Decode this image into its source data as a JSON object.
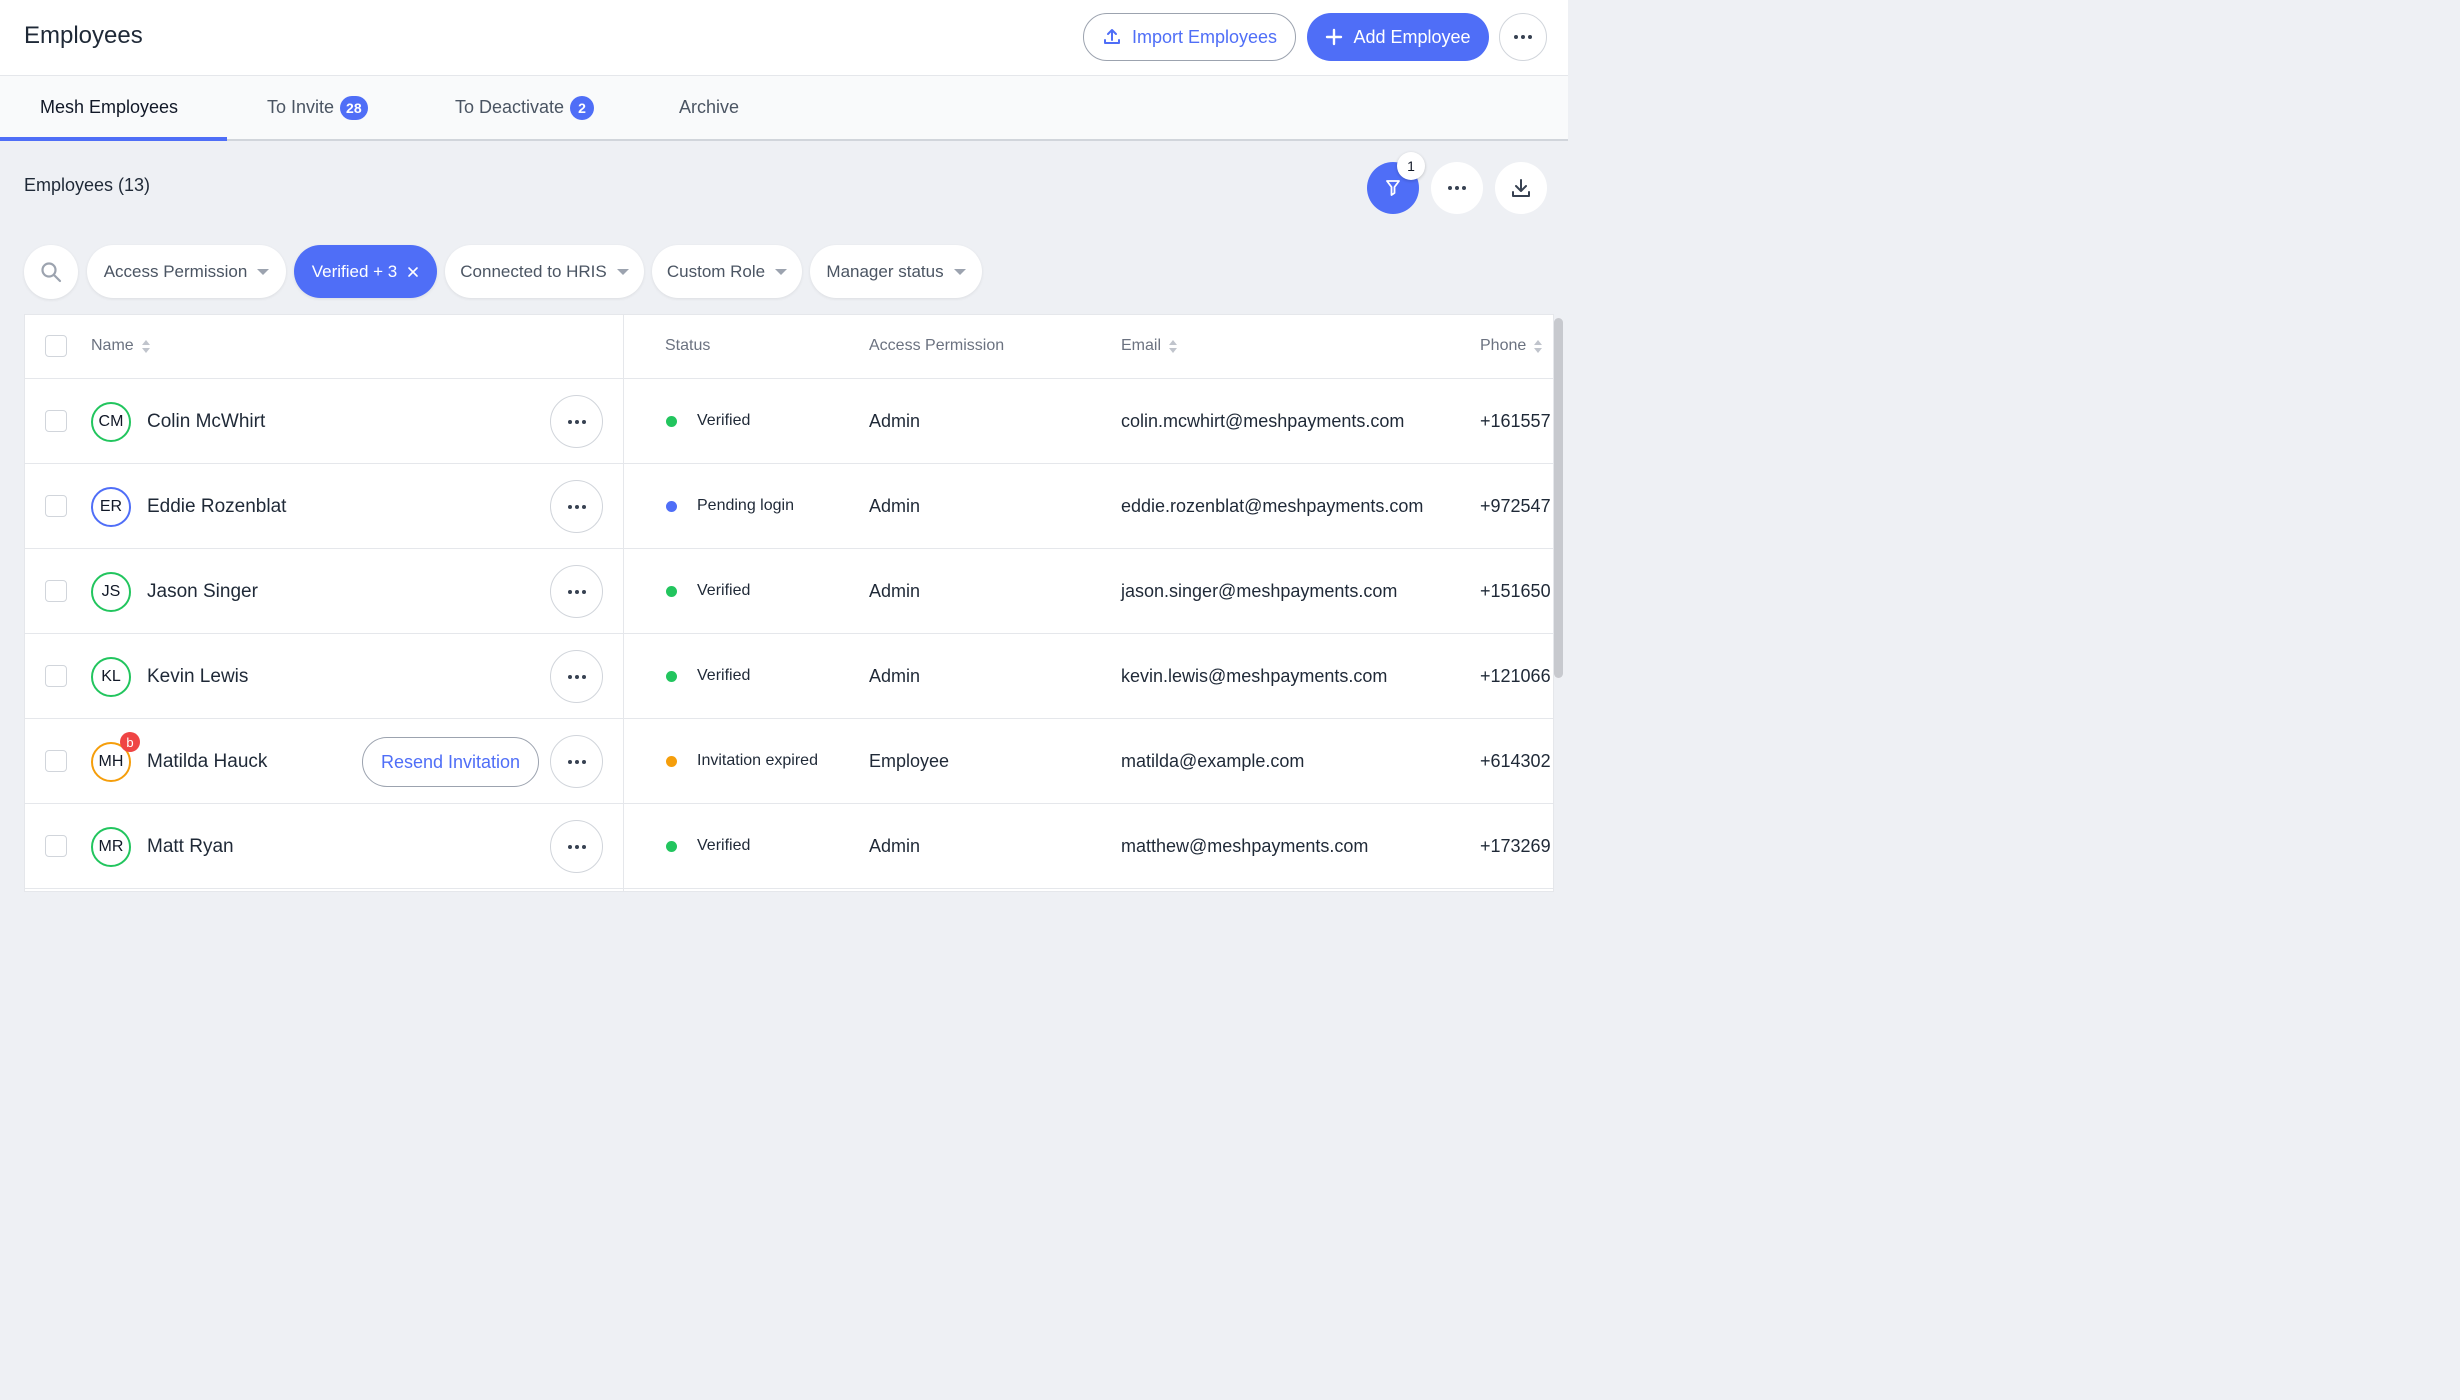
{
  "header": {
    "title": "Employees",
    "import_label": "Import Employees",
    "add_label": "Add Employee",
    "accent": "#4f6ef7"
  },
  "tabs": [
    {
      "label": "Mesh Employees",
      "badge": null,
      "active": true
    },
    {
      "label": "To Invite",
      "badge": "28",
      "active": false
    },
    {
      "label": "To Deactivate",
      "badge": "2",
      "active": false
    },
    {
      "label": "Archive",
      "badge": null,
      "active": false
    }
  ],
  "section": {
    "title": "Employees (13)",
    "filter_count": "1"
  },
  "filters": [
    {
      "label": "Access Permission",
      "active": false
    },
    {
      "label": "Verified + 3",
      "active": true
    },
    {
      "label": "Connected to HRIS",
      "active": false
    },
    {
      "label": "Custom Role",
      "active": false
    },
    {
      "label": "Manager status",
      "active": false
    }
  ],
  "table": {
    "columns": {
      "name": "Name",
      "status": "Status",
      "access": "Access Permission",
      "email": "Email",
      "phone": "Phone"
    },
    "rows": [
      {
        "initials": "CM",
        "name": "Colin McWhirt",
        "status": "Verified",
        "status_color": "#22c55e",
        "access": "Admin",
        "email": "colin.mcwhirt@meshpayments.com",
        "phone": "+161557",
        "avatar_color": "#22c55e"
      },
      {
        "initials": "ER",
        "name": "Eddie Rozenblat",
        "status": "Pending login",
        "status_color": "#4f6ef7",
        "access": "Admin",
        "email": "eddie.rozenblat@meshpayments.com",
        "phone": "+972547",
        "avatar_color": "#4f6ef7"
      },
      {
        "initials": "JS",
        "name": "Jason Singer",
        "status": "Verified",
        "status_color": "#22c55e",
        "access": "Admin",
        "email": "jason.singer@meshpayments.com",
        "phone": "+151650",
        "avatar_color": "#22c55e"
      },
      {
        "initials": "KL",
        "name": "Kevin Lewis",
        "status": "Verified",
        "status_color": "#22c55e",
        "access": "Admin",
        "email": "kevin.lewis@meshpayments.com",
        "phone": "+121066",
        "avatar_color": "#22c55e"
      },
      {
        "initials": "MH",
        "name": "Matilda Hauck",
        "status": "Invitation expired",
        "status_color": "#f59e0b",
        "access": "Employee",
        "email": "matilda@example.com",
        "phone": "+614302",
        "avatar_color": "#f59e0b",
        "notif": "b",
        "resend_label": "Resend Invitation"
      },
      {
        "initials": "MR",
        "name": "Matt Ryan",
        "status": "Verified",
        "status_color": "#22c55e",
        "access": "Admin",
        "email": "matthew@meshpayments.com",
        "phone": "+173269",
        "avatar_color": "#22c55e"
      }
    ]
  }
}
